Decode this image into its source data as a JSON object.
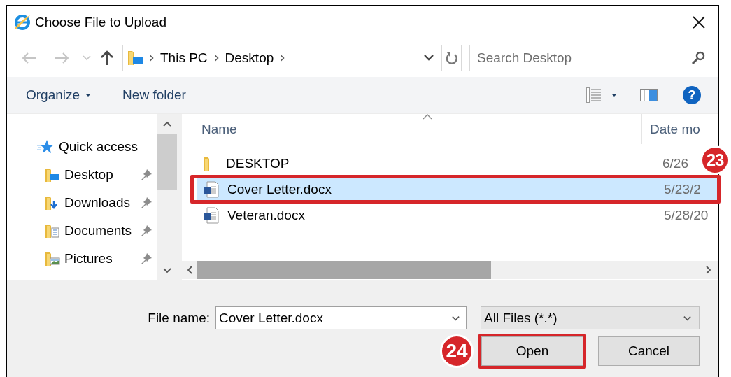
{
  "window": {
    "title": "Choose File to Upload"
  },
  "address": {
    "segments": [
      "This PC",
      "Desktop"
    ]
  },
  "search": {
    "placeholder": "Search Desktop"
  },
  "toolbar": {
    "buttons": [
      {
        "label": "Organize",
        "dropdown": true
      },
      {
        "label": "New folder",
        "dropdown": false
      }
    ],
    "help": "?"
  },
  "sidebar": {
    "items": [
      {
        "label": "Quick access",
        "kind": "quick-access",
        "pinned": false
      },
      {
        "label": "Desktop",
        "kind": "desktop",
        "pinned": true
      },
      {
        "label": "Downloads",
        "kind": "downloads",
        "pinned": true
      },
      {
        "label": "Documents",
        "kind": "documents",
        "pinned": true
      },
      {
        "label": "Pictures",
        "kind": "pictures",
        "pinned": true
      }
    ]
  },
  "file_list": {
    "columns": [
      "Name",
      "Date mo"
    ],
    "rows": [
      {
        "name": "DESKTOP",
        "date": "6/26",
        "kind": "folder",
        "selected": false
      },
      {
        "name": "Cover Letter.docx",
        "date": "5/23/2",
        "kind": "document",
        "selected": true,
        "callout": "23"
      },
      {
        "name": "Veteran.docx",
        "date": "5/28/20",
        "kind": "document",
        "selected": false
      }
    ]
  },
  "file_name": {
    "label": "File name:",
    "value": "Cover Letter.docx"
  },
  "file_type": {
    "value": "All Files (*.*)"
  },
  "buttons": [
    {
      "label": "Open",
      "callout": "24"
    },
    {
      "label": "Cancel"
    }
  ]
}
